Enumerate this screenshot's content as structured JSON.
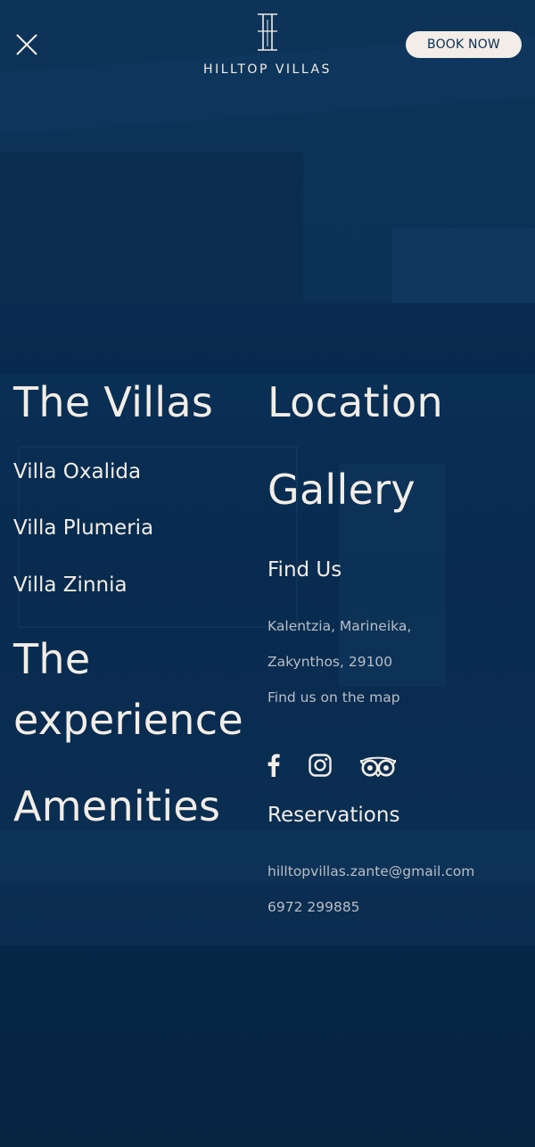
{
  "header": {
    "brand": "HILLTOP VILLAS",
    "book_label": "BOOK NOW",
    "close_icon": "close-icon"
  },
  "menu": {
    "villas": {
      "title": "The Villas",
      "items": [
        "Villa Oxalida",
        "Villa Plumeria",
        "Villa Zinnia"
      ]
    },
    "experience": [
      "The",
      "experience"
    ],
    "amenities": "Amenities",
    "location": "Location",
    "gallery": "Gallery"
  },
  "find_us": {
    "title": "Find Us",
    "address_line1": "Kalentzia, Marineika,",
    "address_line2": "Zakynthos, 29100",
    "map_link": "Find us on the map"
  },
  "social": [
    "facebook-icon",
    "instagram-icon",
    "tripadvisor-icon"
  ],
  "reservations": {
    "title": "Reservations",
    "email": "hilltopvillas.zante@gmail.com",
    "phone": "6972 299885"
  },
  "colors": {
    "background": "#0b3157",
    "text": "#f2ede6",
    "muted": "#b9bec6",
    "button_bg": "#f2ede6",
    "button_text": "#0b2d52"
  }
}
